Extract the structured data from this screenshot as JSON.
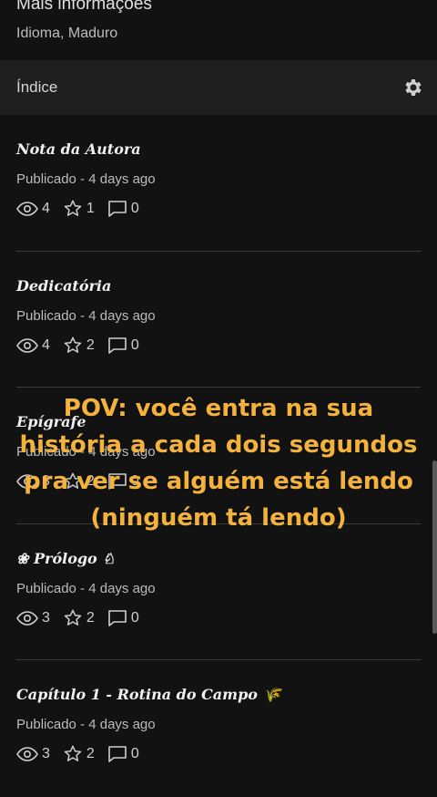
{
  "more_info": {
    "title": "Mais informações",
    "subtitle": "Idioma, Maduro"
  },
  "toc": {
    "title": "Índice",
    "settings_icon": "gear-icon"
  },
  "chapters": [
    {
      "title": "Nota da Autora",
      "status": "Publicado - 4 days ago",
      "views": "4",
      "votes": "1",
      "comments": "0"
    },
    {
      "title": "Dedicatória",
      "status": "Publicado - 4 days ago",
      "views": "4",
      "votes": "2",
      "comments": "0"
    },
    {
      "title": "Epígrafe",
      "status": "Publicado - 4 days ago",
      "views": "3",
      "votes": "2",
      "comments": "0"
    },
    {
      "title": "❀ Prólogo ♘",
      "status": "Publicado - 4 days ago",
      "views": "3",
      "votes": "2",
      "comments": "0"
    },
    {
      "title": "Capítulo 1 - Rotina do Campo 🌾",
      "status": "Publicado - 4 days ago",
      "views": "3",
      "votes": "2",
      "comments": "0"
    }
  ],
  "overlay": {
    "lines": [
      "POV: você entra na sua",
      "história a cada dois segundos",
      "pra ver se alguém está lendo",
      "(ninguém tá lendo)"
    ],
    "color": "#f2b23c"
  }
}
